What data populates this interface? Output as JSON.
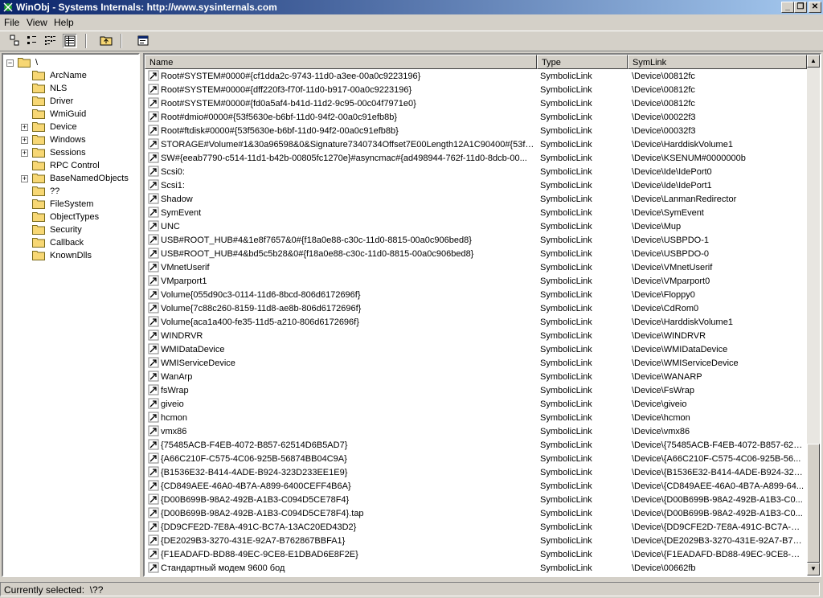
{
  "window": {
    "title": "WinObj - Systems Internals: http://www.sysinternals.com",
    "minimize_glyph": "_",
    "restore_glyph": "❐",
    "close_glyph": "✕"
  },
  "menu": [
    "File",
    "View",
    "Help"
  ],
  "tree": {
    "root": "\\",
    "items": [
      {
        "label": "ArcName",
        "expandable": false
      },
      {
        "label": "NLS",
        "expandable": false
      },
      {
        "label": "Driver",
        "expandable": false
      },
      {
        "label": "WmiGuid",
        "expandable": false
      },
      {
        "label": "Device",
        "expandable": true
      },
      {
        "label": "Windows",
        "expandable": true
      },
      {
        "label": "Sessions",
        "expandable": true
      },
      {
        "label": "RPC Control",
        "expandable": false
      },
      {
        "label": "BaseNamedObjects",
        "expandable": true
      },
      {
        "label": "??",
        "expandable": false,
        "open": true
      },
      {
        "label": "FileSystem",
        "expandable": false
      },
      {
        "label": "ObjectTypes",
        "expandable": false
      },
      {
        "label": "Security",
        "expandable": false
      },
      {
        "label": "Callback",
        "expandable": false
      },
      {
        "label": "KnownDlls",
        "expandable": false
      }
    ]
  },
  "list": {
    "columns": [
      "Name",
      "Type",
      "SymLink"
    ],
    "rows": [
      [
        "Root#SYSTEM#0000#{cf1dda2c-9743-11d0-a3ee-00a0c9223196}",
        "SymbolicLink",
        "\\Device\\00812fc"
      ],
      [
        "Root#SYSTEM#0000#{dff220f3-f70f-11d0-b917-00a0c9223196}",
        "SymbolicLink",
        "\\Device\\00812fc"
      ],
      [
        "Root#SYSTEM#0000#{fd0a5af4-b41d-11d2-9c95-00c04f7971e0}",
        "SymbolicLink",
        "\\Device\\00812fc"
      ],
      [
        "Root#dmio#0000#{53f5630e-b6bf-11d0-94f2-00a0c91efb8b}",
        "SymbolicLink",
        "\\Device\\00022f3"
      ],
      [
        "Root#ftdisk#0000#{53f5630e-b6bf-11d0-94f2-00a0c91efb8b}",
        "SymbolicLink",
        "\\Device\\00032f3"
      ],
      [
        "STORAGE#Volume#1&30a96598&0&Signature7340734Offset7E00Length12A1C90400#{53f5...",
        "SymbolicLink",
        "\\Device\\HarddiskVolume1"
      ],
      [
        "SW#{eeab7790-c514-11d1-b42b-00805fc1270e}#asyncmac#{ad498944-762f-11d0-8dcb-00...",
        "SymbolicLink",
        "\\Device\\KSENUM#0000000b"
      ],
      [
        "Scsi0:",
        "SymbolicLink",
        "\\Device\\Ide\\IdePort0"
      ],
      [
        "Scsi1:",
        "SymbolicLink",
        "\\Device\\Ide\\IdePort1"
      ],
      [
        "Shadow",
        "SymbolicLink",
        "\\Device\\LanmanRedirector"
      ],
      [
        "SymEvent",
        "SymbolicLink",
        "\\Device\\SymEvent"
      ],
      [
        "UNC",
        "SymbolicLink",
        "\\Device\\Mup"
      ],
      [
        "USB#ROOT_HUB#4&1e8f7657&0#{f18a0e88-c30c-11d0-8815-00a0c906bed8}",
        "SymbolicLink",
        "\\Device\\USBPDO-1"
      ],
      [
        "USB#ROOT_HUB#4&bd5c5b28&0#{f18a0e88-c30c-11d0-8815-00a0c906bed8}",
        "SymbolicLink",
        "\\Device\\USBPDO-0"
      ],
      [
        "VMnetUserif",
        "SymbolicLink",
        "\\Device\\VMnetUserif"
      ],
      [
        "VMparport1",
        "SymbolicLink",
        "\\Device\\VMparport0"
      ],
      [
        "Volume{055d90c3-0114-11d6-8bcd-806d6172696f}",
        "SymbolicLink",
        "\\Device\\Floppy0"
      ],
      [
        "Volume{7c88c260-8159-11d8-ae8b-806d6172696f}",
        "SymbolicLink",
        "\\Device\\CdRom0"
      ],
      [
        "Volume{aca1a400-fe35-11d5-a210-806d6172696f}",
        "SymbolicLink",
        "\\Device\\HarddiskVolume1"
      ],
      [
        "WINDRVR",
        "SymbolicLink",
        "\\Device\\WINDRVR"
      ],
      [
        "WMIDataDevice",
        "SymbolicLink",
        "\\Device\\WMIDataDevice"
      ],
      [
        "WMIServiceDevice",
        "SymbolicLink",
        "\\Device\\WMIServiceDevice"
      ],
      [
        "WanArp",
        "SymbolicLink",
        "\\Device\\WANARP"
      ],
      [
        "fsWrap",
        "SymbolicLink",
        "\\Device\\FsWrap"
      ],
      [
        "giveio",
        "SymbolicLink",
        "\\Device\\giveio"
      ],
      [
        "hcmon",
        "SymbolicLink",
        "\\Device\\hcmon"
      ],
      [
        "vmx86",
        "SymbolicLink",
        "\\Device\\vmx86"
      ],
      [
        "{75485ACB-F4EB-4072-B857-62514D6B5AD7}",
        "SymbolicLink",
        "\\Device\\{75485ACB-F4EB-4072-B857-625..."
      ],
      [
        "{A66C210F-C575-4C06-925B-56874BB04C9A}",
        "SymbolicLink",
        "\\Device\\{A66C210F-C575-4C06-925B-56..."
      ],
      [
        "{B1536E32-B414-4ADE-B924-323D233EE1E9}",
        "SymbolicLink",
        "\\Device\\{B1536E32-B414-4ADE-B924-323..."
      ],
      [
        "{CD849AEE-46A0-4B7A-A899-6400CEFF4B6A}",
        "SymbolicLink",
        "\\Device\\{CD849AEE-46A0-4B7A-A899-64..."
      ],
      [
        "{D00B699B-98A2-492B-A1B3-C094D5CE78F4}",
        "SymbolicLink",
        "\\Device\\{D00B699B-98A2-492B-A1B3-C0..."
      ],
      [
        "{D00B699B-98A2-492B-A1B3-C094D5CE78F4}.tap",
        "SymbolicLink",
        "\\Device\\{D00B699B-98A2-492B-A1B3-C0..."
      ],
      [
        "{DD9CFE2D-7E8A-491C-BC7A-13AC20ED43D2}",
        "SymbolicLink",
        "\\Device\\{DD9CFE2D-7E8A-491C-BC7A-13..."
      ],
      [
        "{DE2029B3-3270-431E-92A7-B762867BBFA1}",
        "SymbolicLink",
        "\\Device\\{DE2029B3-3270-431E-92A7-B76..."
      ],
      [
        "{F1EADAFD-BD88-49EC-9CE8-E1DBAD6E8F2E}",
        "SymbolicLink",
        "\\Device\\{F1EADAFD-BD88-49EC-9CE8-E1..."
      ],
      [
        "Стандартный модем  9600 бод",
        "SymbolicLink",
        "\\Device\\00662fb"
      ]
    ]
  },
  "status": {
    "label": "Currently selected:",
    "value": "\\??"
  },
  "scroll": {
    "up_glyph": "▲",
    "down_glyph": "▼"
  },
  "colors": {
    "titlebar_start": "#0a246a",
    "titlebar_end": "#a6caf0",
    "face": "#d4d0c8",
    "folder": "#f7d774"
  }
}
